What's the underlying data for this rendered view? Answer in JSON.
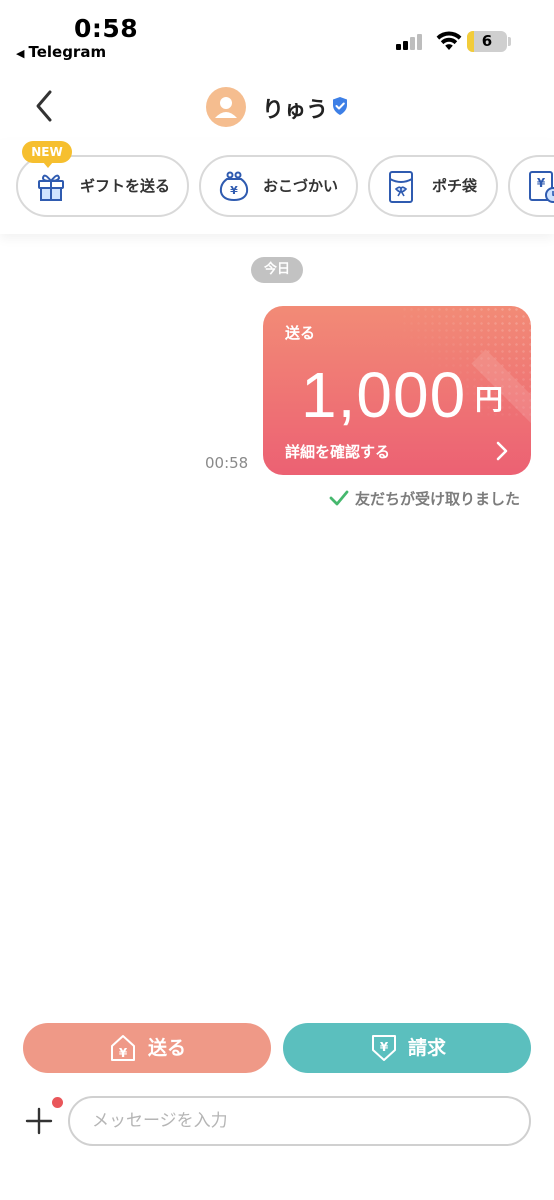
{
  "status_bar": {
    "time": "0:58",
    "back_app": "Telegram",
    "battery": "6"
  },
  "header": {
    "contact_name": "りゅう",
    "icons": {
      "back": "chevron-left-icon",
      "avatar": "person-icon",
      "verified": "verified-badge-icon"
    }
  },
  "actions": {
    "new_badge": "NEW",
    "items": [
      {
        "label": "ギフトを送る",
        "icon": "gift-icon"
      },
      {
        "label": "おこづかい",
        "icon": "coin-purse-icon"
      },
      {
        "label": "ポチ袋",
        "icon": "envelope-icon"
      },
      {
        "label": "",
        "icon": "scheduled-yen-icon"
      }
    ]
  },
  "chat": {
    "date_label": "今日",
    "message": {
      "time": "00:58",
      "card_type": "送る",
      "amount": "1,000",
      "currency": "円",
      "detail_link": "詳細を確認する",
      "status": "友だちが受け取りました"
    }
  },
  "footer": {
    "send_label": "送る",
    "request_label": "請求",
    "input_placeholder": "メッセージを入力"
  },
  "colors": {
    "send": "#ef9987",
    "request": "#5bbfbe",
    "card_top": "#f28b76",
    "card_bottom": "#ec6173",
    "badge": "#f6bf2f",
    "verified": "#3d7fe6",
    "check": "#46b86e"
  }
}
